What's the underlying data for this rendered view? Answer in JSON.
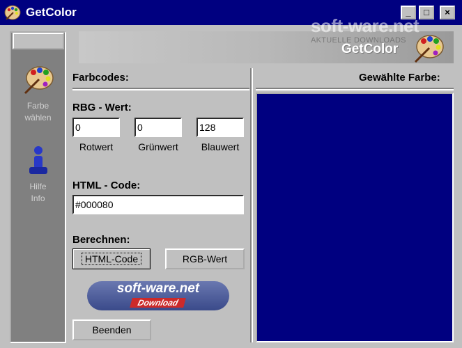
{
  "window": {
    "title": "GetColor",
    "controls": {
      "minimize": "_",
      "maximize": "□",
      "close": "×"
    }
  },
  "watermark": {
    "brand": "soft-ware.net",
    "tagline": "AKTUELLE DOWNLOADS"
  },
  "banner": {
    "text": "GetColor"
  },
  "sidebar": {
    "items": [
      {
        "label_line1": "Farbe",
        "label_line2": "wählen",
        "icon": "palette-icon"
      },
      {
        "label_line1": "Hilfe",
        "label_line2": "Info",
        "icon": "info-person-icon"
      }
    ]
  },
  "main": {
    "farbcodes_label": "Farbcodes:",
    "selected_color_label": "Gewählte Farbe:",
    "rgb_label": "RBG - Wert:",
    "red_value": "0",
    "green_value": "0",
    "blue_value": "128",
    "red_label": "Rotwert",
    "green_label": "Grünwert",
    "blue_label": "Blauwert",
    "html_label": "HTML - Code:",
    "html_value": "#000080",
    "calc_label": "Berechnen:",
    "html_button": "HTML-Code",
    "rgb_button": "RGB-Wert",
    "exit_button": "Beenden"
  },
  "logo": {
    "line1": "soft-ware.net",
    "line2": "Download"
  },
  "colors": {
    "selected_color": "#000080",
    "titlebar": "#000080"
  }
}
